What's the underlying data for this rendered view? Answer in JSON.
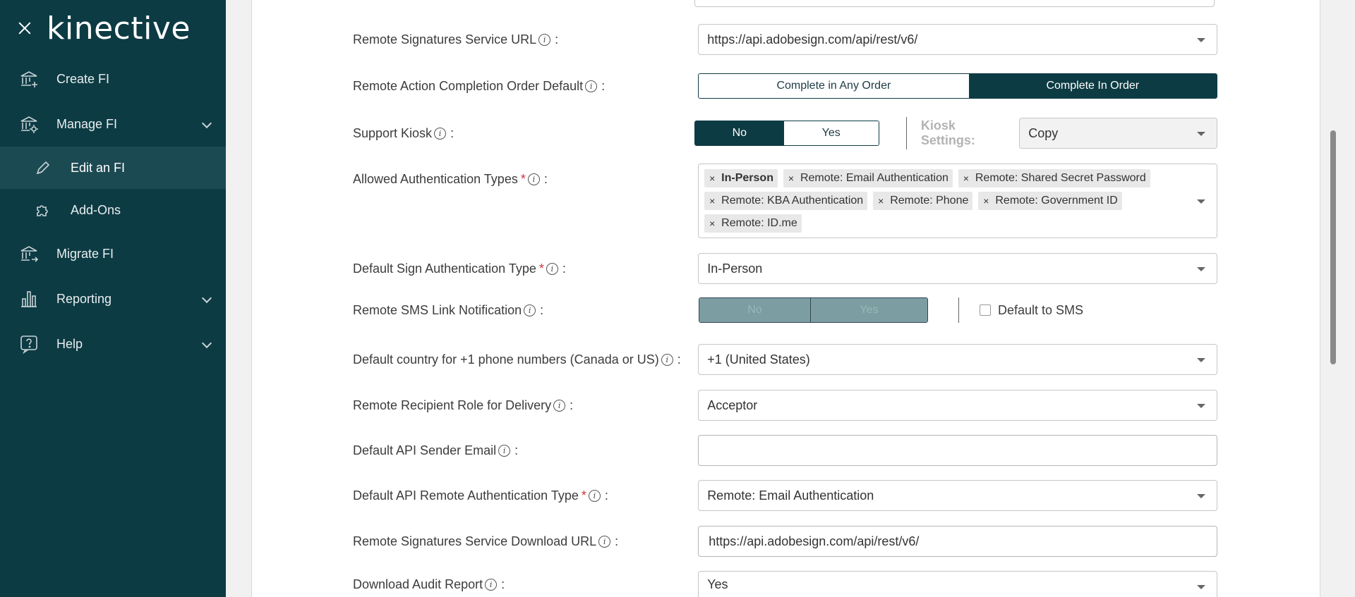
{
  "brand": {
    "name": "kinective"
  },
  "sidebar": {
    "items": [
      {
        "label": "Create FI",
        "icon": "bank-plus-icon"
      },
      {
        "label": "Manage FI",
        "icon": "bank-gear-icon",
        "expanded": true,
        "children": [
          {
            "label": "Edit an FI",
            "icon": "pencil-icon",
            "active": true
          },
          {
            "label": "Add-Ons",
            "icon": "puzzle-icon"
          }
        ]
      },
      {
        "label": "Migrate FI",
        "icon": "bank-arrow-icon"
      },
      {
        "label": "Reporting",
        "icon": "bar-chart-icon"
      },
      {
        "label": "Help",
        "icon": "help-bubble-icon"
      }
    ]
  },
  "form": {
    "service_url": {
      "label": "Remote Signatures Service URL",
      "value": "https://api.adobesign.com/api/rest/v6/"
    },
    "completion_order": {
      "label": "Remote Action Completion Order Default",
      "options": [
        "Complete in Any Order",
        "Complete In Order"
      ],
      "selected": "Complete In Order"
    },
    "kiosk": {
      "label": "Support Kiosk",
      "options": [
        "No",
        "Yes"
      ],
      "selected": "No",
      "settings_label": "Kiosk Settings:",
      "settings_value": "Copy"
    },
    "auth_types": {
      "label": "Allowed Authentication Types",
      "tags": [
        "In-Person",
        "Remote: Email Authentication",
        "Remote: Shared Secret Password",
        "Remote: KBA Authentication",
        "Remote: Phone",
        "Remote: Government ID",
        "Remote: ID.me"
      ]
    },
    "default_sign_auth": {
      "label": "Default Sign Authentication Type",
      "value": "In-Person"
    },
    "sms_link": {
      "label": "Remote SMS Link Notification",
      "options": [
        "No",
        "Yes"
      ],
      "checkbox_label": "Default to SMS"
    },
    "default_country": {
      "label": "Default country for +1 phone numbers (Canada or US)",
      "value": "+1 (United States)"
    },
    "recipient_role": {
      "label": "Remote Recipient Role for Delivery",
      "value": "Acceptor"
    },
    "api_sender_email": {
      "label": "Default API Sender Email",
      "value": ""
    },
    "api_remote_auth": {
      "label": "Default API Remote Authentication Type",
      "value": "Remote: Email Authentication"
    },
    "download_url": {
      "label": "Remote Signatures Service Download URL",
      "value": "https://api.adobesign.com/api/rest/v6/"
    },
    "audit_report": {
      "label": "Download Audit Report",
      "value": "Yes"
    }
  },
  "colors": {
    "sidebar_bg": "#0d3b44",
    "active_item_bg": "#1c4a52",
    "brand_accent": "#7ac143",
    "required": "#d0343a"
  }
}
